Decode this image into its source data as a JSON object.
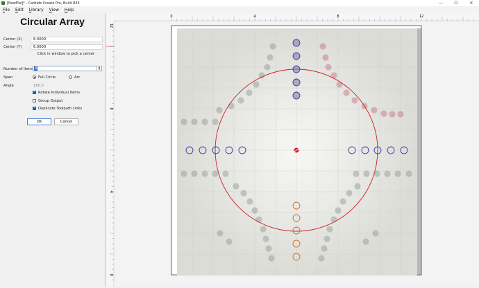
{
  "window": {
    "title": "[NewFile]* - Carbide Create Pro, Build 843",
    "minimize": "—",
    "maximize": "☐",
    "close": "✕"
  },
  "menu": [
    "File",
    "Edit",
    "Library",
    "View",
    "Help"
  ],
  "panel": {
    "title": "Circular Array",
    "center_x_label": "Center (X)",
    "center_x_value": "6.0000",
    "center_y_label": "Center (Y)",
    "center_y_value": "6.0000",
    "hint": "Click in window to pick a center",
    "num_items_label": "Number of Items",
    "num_items_value": "4",
    "span_label": "Span",
    "span_full": "Full Circle",
    "span_arc": "Arc",
    "angle_label": "Angle",
    "angle_value": "180.0",
    "rotate_label": "Rotate Individual Items",
    "group_label": "Group Output",
    "duplicate_label": "Duplicate Toolpath Links",
    "ok_label": "OK",
    "cancel_label": "Cancel"
  },
  "ruler": {
    "top": [
      "0",
      "4",
      "8",
      "12"
    ],
    "left": [
      "12",
      "8",
      "4",
      "0"
    ]
  },
  "colors": {
    "selection": "#3a3aaa",
    "circle": "#c82020",
    "orange": "#d07020",
    "accent": "#1f5fbf"
  }
}
